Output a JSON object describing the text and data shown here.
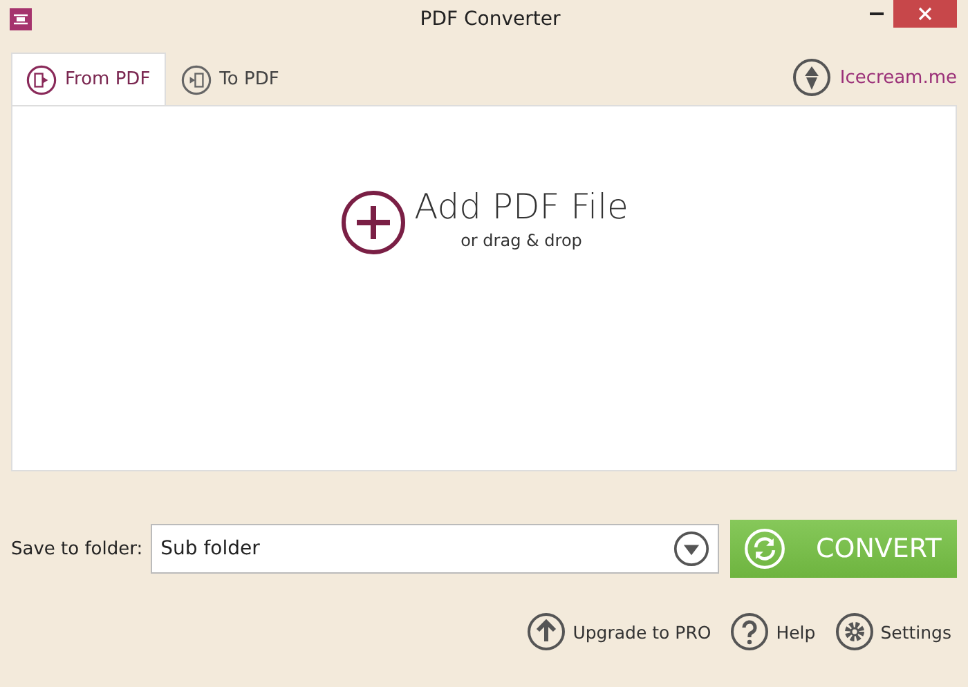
{
  "window": {
    "title": "PDF Converter"
  },
  "tabs": [
    {
      "label": "From PDF",
      "kind": "from",
      "selected": true
    },
    {
      "label": "To PDF",
      "kind": "to",
      "selected": false
    }
  ],
  "brand_link": {
    "label": "Icecream.me"
  },
  "drop_area": {
    "title": "Add PDF File",
    "subtitle": "or drag & drop"
  },
  "save_folder": {
    "label": "Save to folder:",
    "value": "Sub folder"
  },
  "convert_button": {
    "label": "CONVERT"
  },
  "footer_links": [
    {
      "label": "Upgrade to PRO",
      "kind": "upgrade"
    },
    {
      "label": "Help",
      "kind": "help"
    },
    {
      "label": "Settings",
      "kind": "settings"
    }
  ]
}
